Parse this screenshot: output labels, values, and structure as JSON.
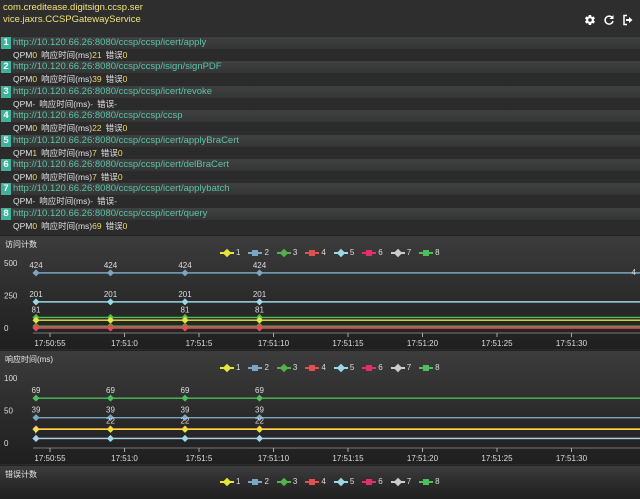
{
  "header": {
    "service_line1": "com.creditease.digitsign.ccsp.ser",
    "service_line2": "vice.jaxrs.CCSPGatewayService",
    "icons": [
      "gear-icon",
      "refresh-icon",
      "logout-icon"
    ]
  },
  "stats_labels": {
    "qpm": "QPM",
    "resp": "响应时间(ms)",
    "err": "错误"
  },
  "endpoints": [
    {
      "num": "1",
      "url": "http://10.120.66.26:8080/ccsp/ccsp/icert/apply",
      "qpm": "0",
      "resp": "21",
      "err": "0"
    },
    {
      "num": "2",
      "url": "http://10.120.66.26:8080/ccsp/ccsp/isign/signPDF",
      "qpm": "0",
      "resp": "39",
      "err": "0"
    },
    {
      "num": "3",
      "url": "http://10.120.66.26:8080/ccsp/ccsp/icert/revoke",
      "qpm": "-",
      "resp": "-",
      "err": "-"
    },
    {
      "num": "4",
      "url": "http://10.120.66.26:8080/ccsp/ccsp/ccsp",
      "qpm": "0",
      "resp": "22",
      "err": "0"
    },
    {
      "num": "5",
      "url": "http://10.120.66.26:8080/ccsp/ccsp/icert/applyBraCert",
      "qpm": "1",
      "resp": "7",
      "err": "0"
    },
    {
      "num": "6",
      "url": "http://10.120.66.26:8080/ccsp/ccsp/icert/delBraCert",
      "qpm": "0",
      "resp": "7",
      "err": "0"
    },
    {
      "num": "7",
      "url": "http://10.120.66.26:8080/ccsp/ccsp/icert/applybatch",
      "qpm": "-",
      "resp": "-",
      "err": "-"
    },
    {
      "num": "8",
      "url": "http://10.120.66.26:8080/ccsp/ccsp/icert/query",
      "qpm": "0",
      "resp": "69",
      "err": "0"
    }
  ],
  "panels": [
    {
      "title": "访问计数"
    },
    {
      "title": "响应时间(ms)"
    },
    {
      "title": "错误计数"
    }
  ],
  "legend_series": [
    {
      "name": "1",
      "color": "#e6e63a"
    },
    {
      "name": "2",
      "color": "#7aa6c2"
    },
    {
      "name": "3",
      "color": "#53b04a"
    },
    {
      "name": "4",
      "color": "#e05050"
    },
    {
      "name": "5",
      "color": "#9ad8e8"
    },
    {
      "name": "6",
      "color": "#e0306a"
    },
    {
      "name": "7",
      "color": "#cccccc"
    },
    {
      "name": "8",
      "color": "#4cbf5a"
    }
  ],
  "chart_data": [
    {
      "type": "line",
      "title": "访问计数",
      "x": [
        "17:50:55",
        "17:51:0",
        "17:51:5",
        "17:51:10",
        "17:51:15",
        "17:51:20",
        "17:51:25",
        "17:51:30"
      ],
      "y_ticks": [
        "0",
        "250",
        "500"
      ],
      "ylim": [
        0,
        500
      ],
      "points_x": [
        "17:50:55",
        "17:51:0",
        "17:51:5",
        "17:51:10"
      ],
      "series": [
        {
          "name": "2",
          "values": [
            424,
            424,
            424,
            424
          ],
          "labels": [
            "424",
            "424",
            "424",
            "424"
          ]
        },
        {
          "name": "5",
          "values": [
            201,
            201,
            201,
            201
          ],
          "labels": [
            "201",
            "201",
            "201",
            "201"
          ]
        },
        {
          "name": "8",
          "values": [
            81,
            81,
            81,
            81
          ],
          "labels": [
            "81",
            "",
            "81",
            "81"
          ]
        },
        {
          "name": "1",
          "values": [
            60,
            60,
            60,
            60
          ]
        },
        {
          "name": "3",
          "values": [
            14,
            14,
            14,
            14
          ]
        },
        {
          "name": "6",
          "values": [
            4,
            4,
            4,
            4
          ]
        },
        {
          "name": "4",
          "values": [
            0,
            0,
            0,
            0
          ]
        }
      ],
      "edge_label": "4"
    },
    {
      "type": "line",
      "title": "响应时间(ms)",
      "x": [
        "17:50:55",
        "17:51:0",
        "17:51:5",
        "17:51:10",
        "17:51:15",
        "17:51:20",
        "17:51:25",
        "17:51:30"
      ],
      "y_ticks": [
        "0",
        "50",
        "100"
      ],
      "ylim": [
        0,
        100
      ],
      "points_x": [
        "17:50:55",
        "17:51:0",
        "17:51:5",
        "17:51:10"
      ],
      "series": [
        {
          "name": "8",
          "values": [
            69,
            69,
            69,
            69
          ],
          "labels": [
            "69",
            "69",
            "69",
            "69"
          ]
        },
        {
          "name": "2",
          "values": [
            39,
            39,
            39,
            39
          ],
          "labels": [
            "39",
            "39",
            "39",
            "39"
          ]
        },
        {
          "name": "4",
          "values": [
            22,
            22,
            22,
            22
          ],
          "labels": [
            "",
            "22",
            "22",
            "22"
          ]
        },
        {
          "name": "1",
          "values": [
            21,
            21,
            21,
            21
          ]
        },
        {
          "name": "6",
          "values": [
            7,
            7,
            7,
            7
          ],
          "labels": [
            "7",
            "",
            "",
            ""
          ]
        },
        {
          "name": "5",
          "values": [
            7,
            7,
            7,
            7
          ]
        }
      ]
    },
    {
      "type": "line",
      "title": "错误计数",
      "series": []
    }
  ]
}
